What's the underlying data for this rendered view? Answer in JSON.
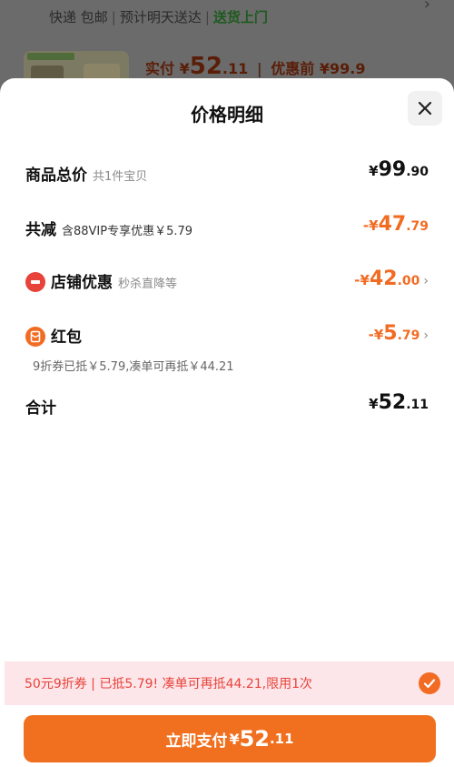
{
  "background": {
    "shipping": "快递 包邮",
    "delivery": "预计明天送达",
    "door": "送货上门",
    "pay_label": "实付",
    "pay_yen": "¥",
    "pay_int": "52",
    "pay_dec": ".11",
    "orig_label": "优惠前 ¥99.9"
  },
  "sheet": {
    "title": "价格明细",
    "rows": {
      "total": {
        "label": "商品总价",
        "sub": "共1件宝贝",
        "yen": "¥",
        "int": "99",
        "dec": ".90"
      },
      "reduce": {
        "label": "共减",
        "sub": "含88VIP专享优惠￥5.79",
        "yen": "-¥",
        "int": "47",
        "dec": ".79"
      },
      "shop": {
        "label": "店铺优惠",
        "sub": "秒杀直降等",
        "yen": "-¥",
        "int": "42",
        "dec": ".00"
      },
      "redpacket": {
        "label": "红包",
        "yen": "-¥",
        "int": "5",
        "dec": ".79",
        "note": "9折券已抵￥5.79,凑单可再抵￥44.21"
      },
      "sum": {
        "label": "合计",
        "yen": "¥",
        "int": "52",
        "dec": ".11"
      }
    }
  },
  "coupon_bar": {
    "text": "50元9折券 | 已抵5.79! 凑单可再抵44.21,限用1次"
  },
  "pay_button": {
    "label": "立即支付",
    "yen": "¥",
    "int": "52",
    "dec": ".11"
  },
  "icons": {
    "close": "close-icon",
    "shop": "shop-discount-icon",
    "redpacket": "red-packet-icon",
    "check": "check-icon"
  },
  "colors": {
    "accent": "#f26b22",
    "red": "#e8433a",
    "coupon_bg": "#fde6ea"
  }
}
